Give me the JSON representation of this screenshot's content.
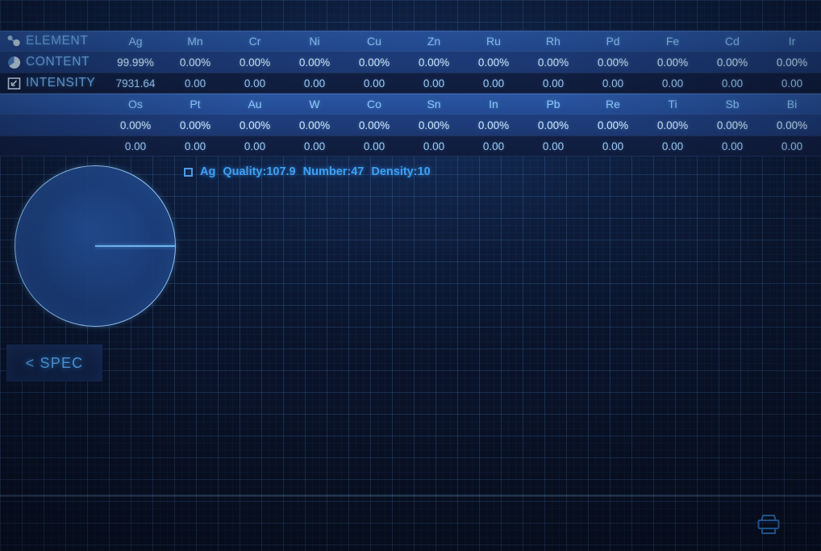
{
  "app": {
    "title": "XRF Spectrometer Analysis Readout",
    "accent_color": "#3f9ff0",
    "header_row_color": "#27509a",
    "content_row_color": "#1e3d7c",
    "intensity_row_color": "#111f43",
    "background_color": "#0b1730"
  },
  "tables": [
    {
      "name": "primary-elements",
      "rows": {
        "element": {
          "icon": "molecule-icon",
          "label": "ELEMENT",
          "values": [
            "Ag",
            "Mn",
            "Cr",
            "Ni",
            "Cu",
            "Zn",
            "Ru",
            "Rh",
            "Pd",
            "Fe",
            "Cd",
            "Ir"
          ]
        },
        "content": {
          "icon": "pie-chart-icon",
          "label": "CONTENT",
          "values": [
            "99.99%",
            "0.00%",
            "0.00%",
            "0.00%",
            "0.00%",
            "0.00%",
            "0.00%",
            "0.00%",
            "0.00%",
            "0.00%",
            "0.00%",
            "0.00%"
          ]
        },
        "intensity": {
          "icon": "expand-arrow-icon",
          "label": "INTENSITY",
          "values": [
            "7931.64",
            "0.00",
            "0.00",
            "0.00",
            "0.00",
            "0.00",
            "0.00",
            "0.00",
            "0.00",
            "0.00",
            "0.00",
            "0.00"
          ]
        }
      }
    },
    {
      "name": "secondary-elements",
      "rows": {
        "element": {
          "icon": "",
          "label": "",
          "values": [
            "Os",
            "Pt",
            "Au",
            "W",
            "Co",
            "Sn",
            "In",
            "Pb",
            "Re",
            "Ti",
            "Sb",
            "Bi"
          ]
        },
        "content": {
          "icon": "",
          "label": "",
          "values": [
            "0.00%",
            "0.00%",
            "0.00%",
            "0.00%",
            "0.00%",
            "0.00%",
            "0.00%",
            "0.00%",
            "0.00%",
            "0.00%",
            "0.00%",
            "0.00%"
          ]
        },
        "intensity": {
          "icon": "",
          "label": "",
          "values": [
            "0.00",
            "0.00",
            "0.00",
            "0.00",
            "0.00",
            "0.00",
            "0.00",
            "0.00",
            "0.00",
            "0.00",
            "0.00",
            "0.00"
          ]
        }
      }
    }
  ],
  "status": {
    "checkbox_checked": false,
    "element": "Ag",
    "quality": "Quality:107.9",
    "number": "Number:47",
    "density": "Density:10"
  },
  "buttons": {
    "spec_label": "< SPEC",
    "print_icon": "printer-icon"
  },
  "chart_data": {
    "type": "pie",
    "title": "",
    "labels": [
      "Ag"
    ],
    "values": [
      99.99
    ],
    "colors": [
      "#24508f"
    ],
    "unit": "%",
    "legend": "none",
    "start_angle": 0,
    "notes": "single full slice; thin radius marker drawn at 0 degrees (pointing right)"
  }
}
